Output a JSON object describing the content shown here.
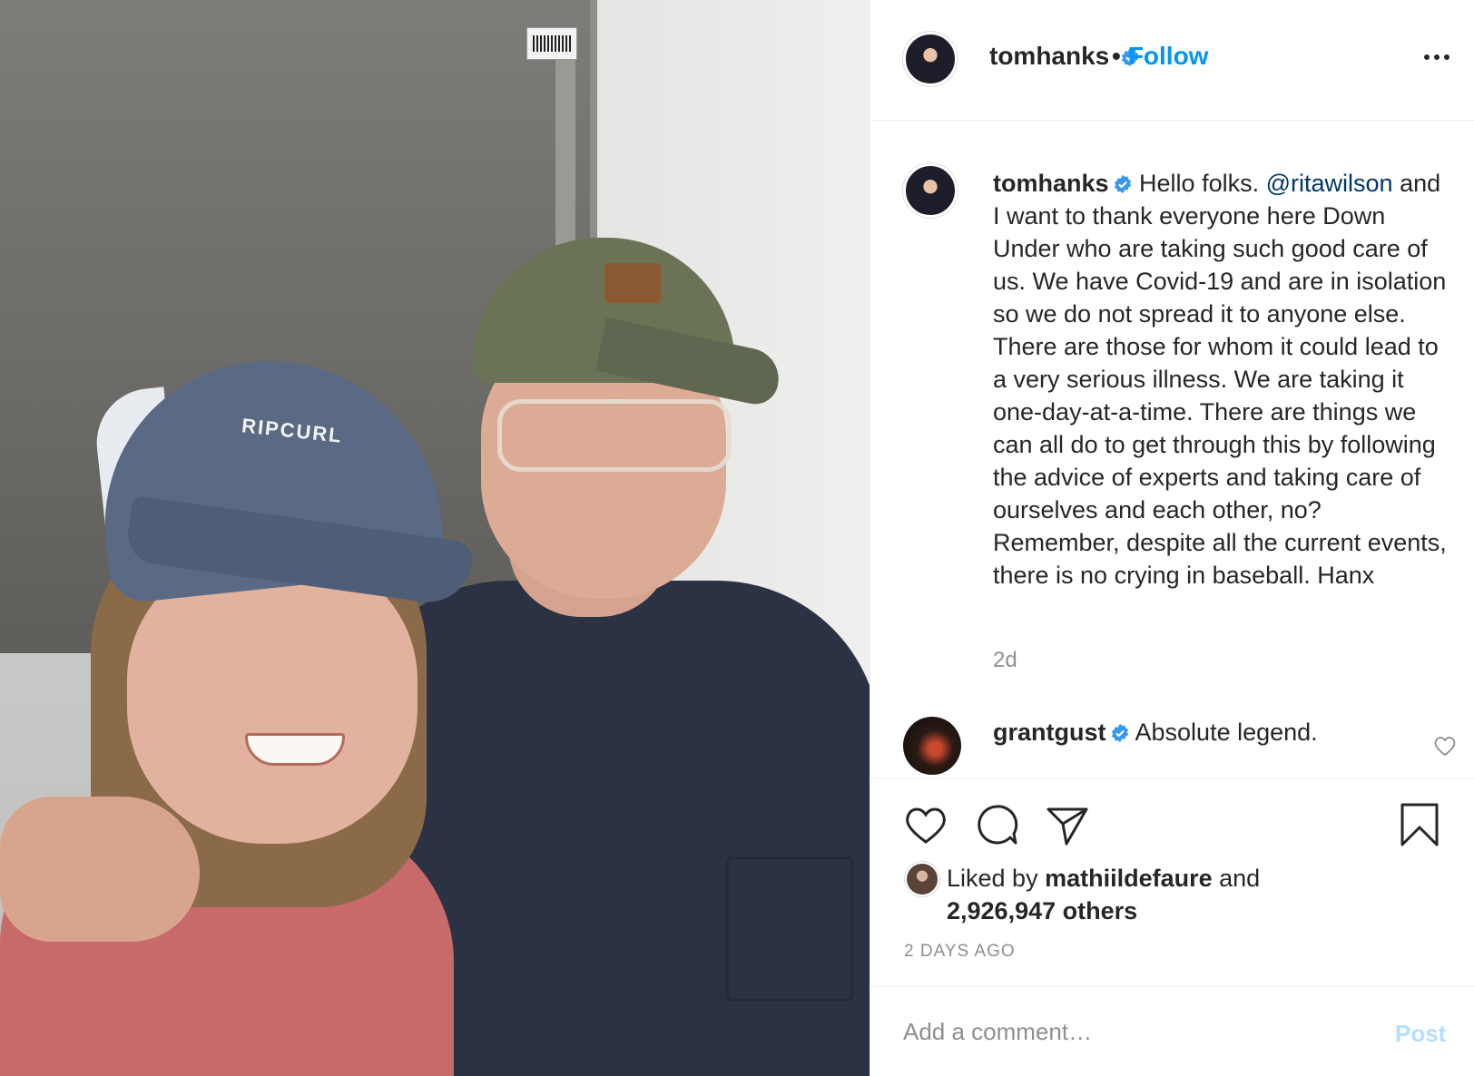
{
  "photo": {
    "cap_text": "RIPCURL"
  },
  "header": {
    "username": "tomhanks",
    "separator": "•",
    "follow_label": "Follow"
  },
  "caption": {
    "username": "tomhanks",
    "text_before": "Hello folks. ",
    "mention": "@ritawilson",
    "text_after": " and I want to thank everyone here Down Under who are taking such good care of us. We have Covid-19 and are in isolation so we do not spread it to anyone else. There are those for whom it could lead to a very serious illness. We are taking it one-day-at-a-time. There are things we can all do to get through this by following the advice of experts and taking care of ourselves and each other, no? Remember, despite all the current events, there is no crying in baseball. Hanx",
    "time": "2d"
  },
  "comment": {
    "username": "grantgust",
    "text": "Absolute legend."
  },
  "likes": {
    "prefix": "Liked by ",
    "user": "mathiildefaure",
    "middle": " and",
    "count": "2,926,947 others"
  },
  "timestamp": "2 DAYS AGO",
  "add_comment": {
    "placeholder": "Add a comment…",
    "post_label": "Post"
  },
  "colors": {
    "accent": "#0095f6",
    "mention": "#00376b",
    "muted": "#8e8e8e"
  }
}
